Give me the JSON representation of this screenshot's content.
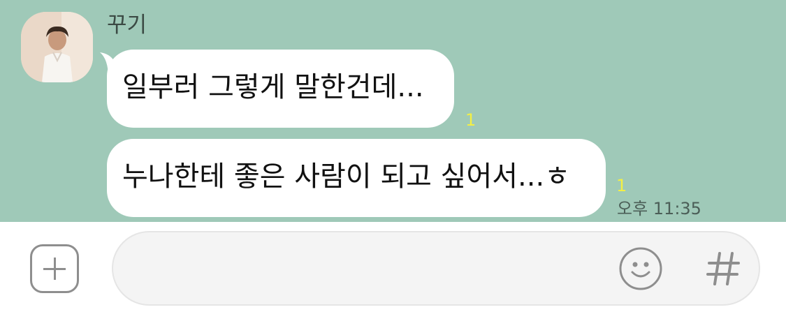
{
  "chat": {
    "sender": "꾸기",
    "messages": [
      {
        "text": "일부러 그렇게 말한건데...",
        "unread": "1"
      },
      {
        "text": "누나한테 좋은 사람이 되고 싶어서...ㅎ",
        "unread": "1"
      }
    ],
    "time": "오후 11:35"
  },
  "input": {
    "value": "",
    "placeholder": ""
  },
  "icons": {
    "plus": "plus-icon",
    "emoji": "emoji-icon",
    "hash": "hash-icon"
  },
  "colors": {
    "chat_background": "#9fc9b8",
    "bubble": "#ffffff",
    "unread_count": "#f3ef43",
    "input_background": "#f4f4f4"
  }
}
